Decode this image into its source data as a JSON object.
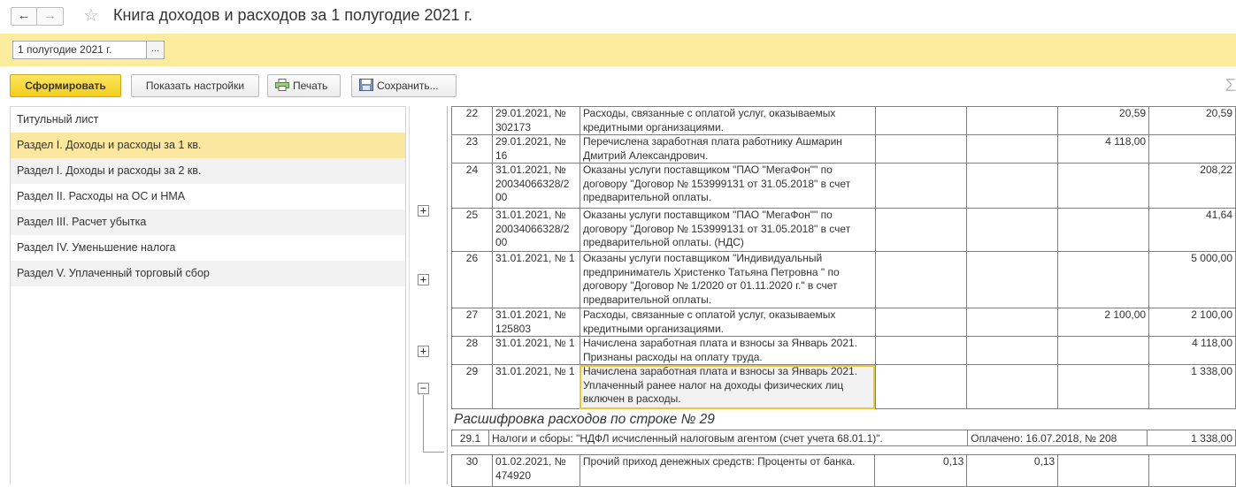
{
  "window": {
    "title": "Книга доходов и расходов за 1 полугодие 2021 г.",
    "back_icon": "arrow-left-icon",
    "forward_icon": "arrow-right-icon",
    "favorite_icon": "star-icon"
  },
  "period": {
    "value": "1 полугодие 2021 г.",
    "select_label": "..."
  },
  "toolbar": {
    "generate_label": "Сформировать",
    "settings_label": "Показать настройки",
    "print_label": "Печать",
    "save_label": "Сохранить...",
    "sum_symbol": "Σ"
  },
  "sidebar": {
    "items": [
      {
        "label": "Титульный лист"
      },
      {
        "label": "Раздел I. Доходы и расходы за 1 кв."
      },
      {
        "label": "Раздел I. Доходы и расходы за 2 кв."
      },
      {
        "label": "Раздел II. Расходы на ОС и НМА"
      },
      {
        "label": "Раздел III. Расчет убытка"
      },
      {
        "label": "Раздел IV. Уменьшение налога"
      },
      {
        "label": "Раздел V. Уплаченный торговый сбор"
      }
    ],
    "selected_index": 1
  },
  "report": {
    "rows": [
      {
        "n": "22",
        "doc": "29.01.2021, № 302173",
        "desc": "Расходы, связанные с оплатой услуг, оказываемых кредитными организациями.",
        "inc": "",
        "inc2": "",
        "exp": "20,59",
        "exp2": "20,59"
      },
      {
        "n": "23",
        "doc": "29.01.2021, № 16",
        "desc": "Перечислена заработная плата работнику Ашмарин Дмитрий Александрович.",
        "inc": "",
        "inc2": "",
        "exp": "4 118,00",
        "exp2": ""
      },
      {
        "n": "24",
        "doc": "31.01.2021, № 20034066328/2 00",
        "desc": "Оказаны услуги поставщиком \"ПАО \"МегаФон\"\" по договору \"Договор № 153999131 от 31.05.2018\" в счет предварительной оплаты.",
        "inc": "",
        "inc2": "",
        "exp": "",
        "exp2": "208,22"
      },
      {
        "n": "25",
        "doc": "31.01.2021, № 20034066328/2 00",
        "desc": "Оказаны услуги поставщиком \"ПАО \"МегаФон\"\" по договору \"Договор № 153999131 от 31.05.2018\" в счет предварительной оплаты. (НДС)",
        "inc": "",
        "inc2": "",
        "exp": "",
        "exp2": "41,64"
      },
      {
        "n": "26",
        "doc": "31.01.2021, № 1",
        "desc": "Оказаны услуги поставщиком \"Индивидуальный предприниматель Христенко Татьяна Петровна \" по договору \"Договор № 1/2020 от 01.11.2020 г.\" в счет предварительной оплаты.",
        "inc": "",
        "inc2": "",
        "exp": "",
        "exp2": "5 000,00"
      },
      {
        "n": "27",
        "doc": "31.01.2021, № 125803",
        "desc": "Расходы, связанные с оплатой услуг, оказываемых кредитными организациями.",
        "inc": "",
        "inc2": "",
        "exp": "2 100,00",
        "exp2": "2 100,00"
      },
      {
        "n": "28",
        "doc": "31.01.2021, № 1",
        "desc": "Начислена заработная плата и взносы за Январь 2021. Признаны расходы на оплату труда.",
        "inc": "",
        "inc2": "",
        "exp": "",
        "exp2": "4 118,00"
      },
      {
        "n": "29",
        "doc": "31.01.2021, № 1",
        "desc": "Начислена заработная плата и взносы за Январь 2021. Уплаченный ранее налог на доходы физических лиц включен в расходы.",
        "inc": "",
        "inc2": "",
        "exp": "",
        "exp2": "1 338,00"
      }
    ],
    "decode_title": "Расшифровка расходов по строке № 29",
    "decode_row": {
      "n": "29.1",
      "desc": "Налоги и сборы: \"НДФЛ исчисленный налоговым агентом (счет учета 68.01.1)\".",
      "paid": "Оплачено: 16.07.2018, № 208",
      "amount": "1 338,00"
    },
    "next_row": {
      "n": "30",
      "doc": "01.02.2021, № 474920",
      "desc": "Прочий приход денежных средств: Проценты от банка.",
      "inc": "0,13",
      "inc2": "0,13",
      "exp": "",
      "exp2": ""
    }
  },
  "colors": {
    "accent_yellow": "#fbec9e",
    "primary_button": "#f4cd1c",
    "selection": "#fbe7a0",
    "highlight_border": "#e9c63a"
  }
}
